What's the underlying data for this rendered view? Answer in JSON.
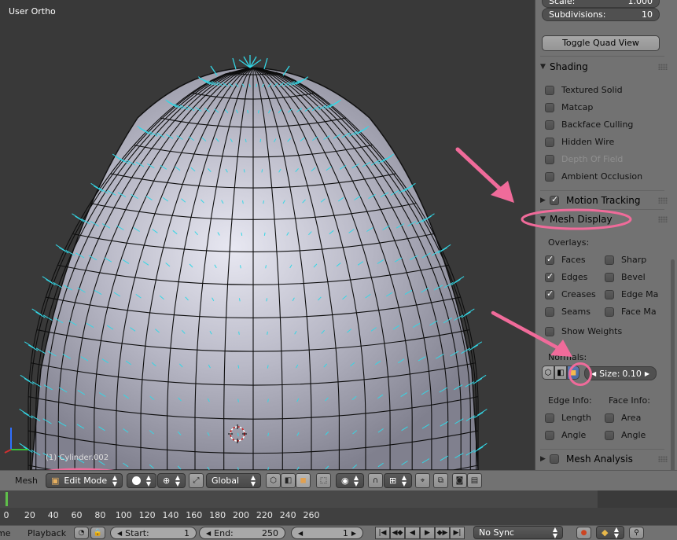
{
  "viewport": {
    "view_label": "User Ortho",
    "object_label": "(1) Cylinder.002"
  },
  "properties": {
    "scale_label": "Scale:",
    "scale_value": "1.000",
    "subdivisions_label": "Subdivisions:",
    "subdivisions_value": "10",
    "toggle_quad_label": "Toggle Quad View",
    "shading": {
      "title": "Shading",
      "items": [
        {
          "label": "Textured Solid",
          "checked": false,
          "enabled": true
        },
        {
          "label": "Matcap",
          "checked": false,
          "enabled": true
        },
        {
          "label": "Backface Culling",
          "checked": false,
          "enabled": true
        },
        {
          "label": "Hidden Wire",
          "checked": false,
          "enabled": true
        },
        {
          "label": "Depth Of Field",
          "checked": false,
          "enabled": false
        },
        {
          "label": "Ambient Occlusion",
          "checked": false,
          "enabled": true
        }
      ]
    },
    "motion_tracking": {
      "title": "Motion Tracking",
      "checked": true
    },
    "mesh_display": {
      "title": "Mesh Display",
      "overlays_label": "Overlays:",
      "overlays_left": [
        {
          "label": "Faces",
          "checked": true
        },
        {
          "label": "Edges",
          "checked": true
        },
        {
          "label": "Creases",
          "checked": true
        },
        {
          "label": "Seams",
          "checked": false
        }
      ],
      "overlays_right": [
        {
          "label": "Sharp",
          "checked": false
        },
        {
          "label": "Bevel",
          "checked": false
        },
        {
          "label": "Edge Ma",
          "checked": false
        },
        {
          "label": "Face Ma",
          "checked": false
        }
      ],
      "show_weights": {
        "label": "Show Weights",
        "checked": false
      },
      "normals_label": "Normals:",
      "size_label": "Size:",
      "size_value": "0.10",
      "edge_info_label": "Edge Info:",
      "face_info_label": "Face Info:",
      "edge_info": [
        {
          "label": "Length",
          "checked": false
        },
        {
          "label": "Angle",
          "checked": false
        }
      ],
      "face_info": [
        {
          "label": "Area",
          "checked": false
        },
        {
          "label": "Angle",
          "checked": false
        }
      ]
    },
    "mesh_analysis": {
      "title": "Mesh Analysis",
      "checked": false
    }
  },
  "header3d": {
    "mesh_menu": "Mesh",
    "mode": "Edit Mode",
    "orientation": "Global"
  },
  "timeline": {
    "ticks": [
      "0",
      "20",
      "40",
      "60",
      "80",
      "100",
      "120",
      "140",
      "160",
      "180",
      "200",
      "220",
      "240",
      "260"
    ]
  },
  "footer": {
    "view_menu_partial": "me",
    "playback_menu": "Playback",
    "start_label": "Start:",
    "start_value": "1",
    "end_label": "End:",
    "end_value": "250",
    "current_frame": "1",
    "sync": "No Sync"
  },
  "colors": {
    "annotation": "#f06b9a",
    "normals": "#33d7e6",
    "panel_bg": "#727272",
    "viewport_bg": "#393939"
  }
}
